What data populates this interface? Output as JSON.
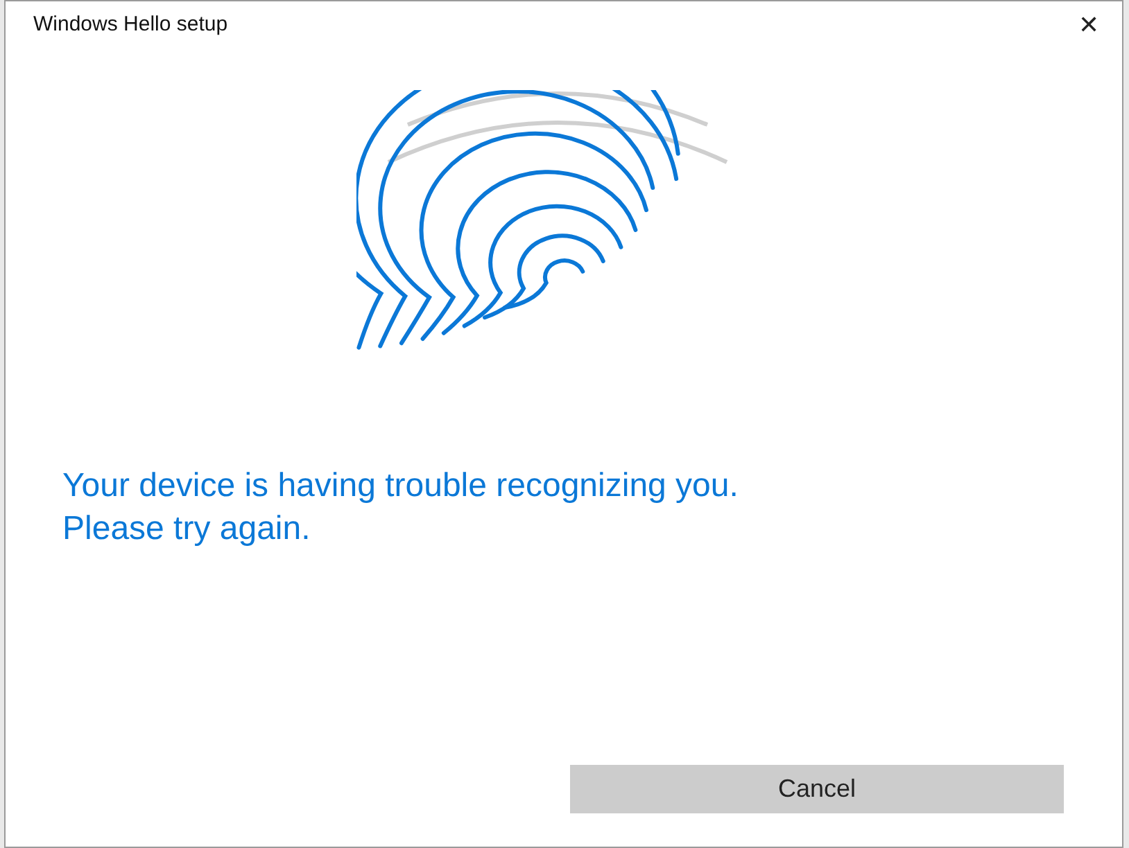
{
  "window": {
    "title": "Windows Hello setup",
    "close": "✕"
  },
  "message": [
    "Your device is having trouble recognizing you.",
    "Please try again."
  ],
  "buttons": [
    "Cancel"
  ]
}
